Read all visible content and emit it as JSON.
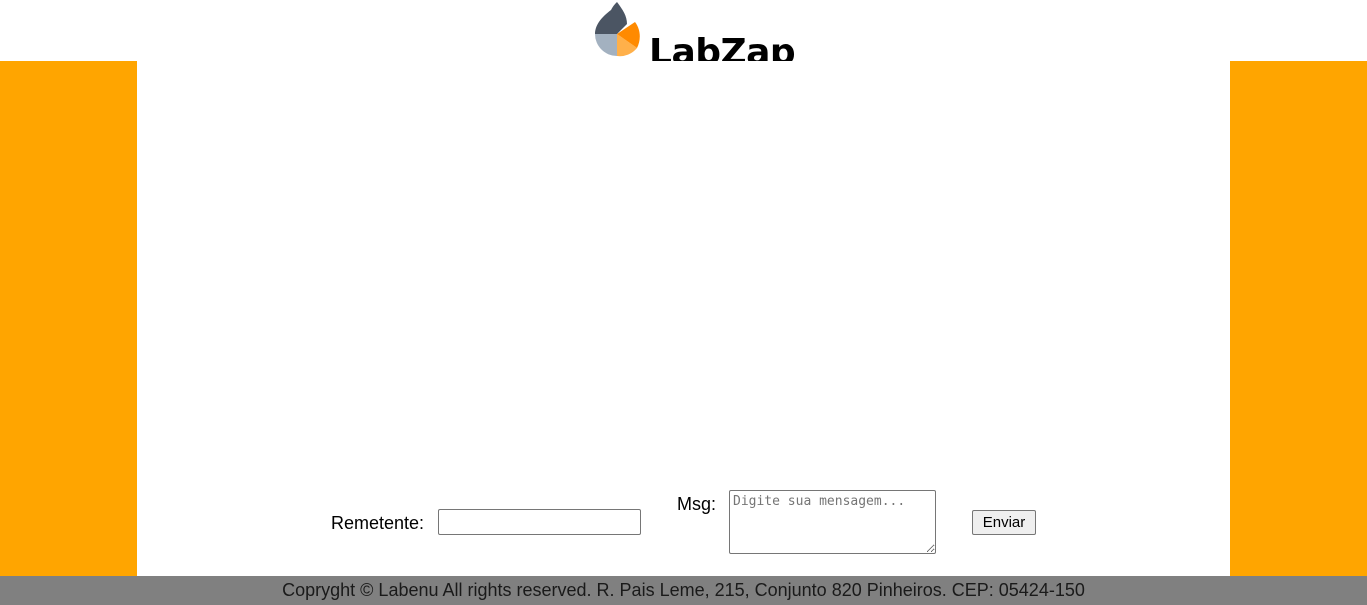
{
  "header": {
    "brand": "LabZap",
    "logo_icon": "labenu-flame-logo-icon"
  },
  "form": {
    "sender_label": "Remetente:",
    "sender_value": "",
    "sender_placeholder": "",
    "message_label": "Msg:",
    "message_value": "",
    "message_placeholder": "Digite sua mensagem...",
    "send_label": "Enviar"
  },
  "footer": {
    "text": "Copryght © Labenu All rights reserved. R. Pais Leme, 215, Conjunto 820 Pinheiros. CEP: 05424-150"
  },
  "colors": {
    "side_panels": "#ffa500",
    "footer_bg": "#808080",
    "logo_dark": "#4b5563",
    "logo_grey": "#a3b1c0",
    "logo_orange": "#ff8a00",
    "logo_light_orange": "#ffb04a"
  }
}
